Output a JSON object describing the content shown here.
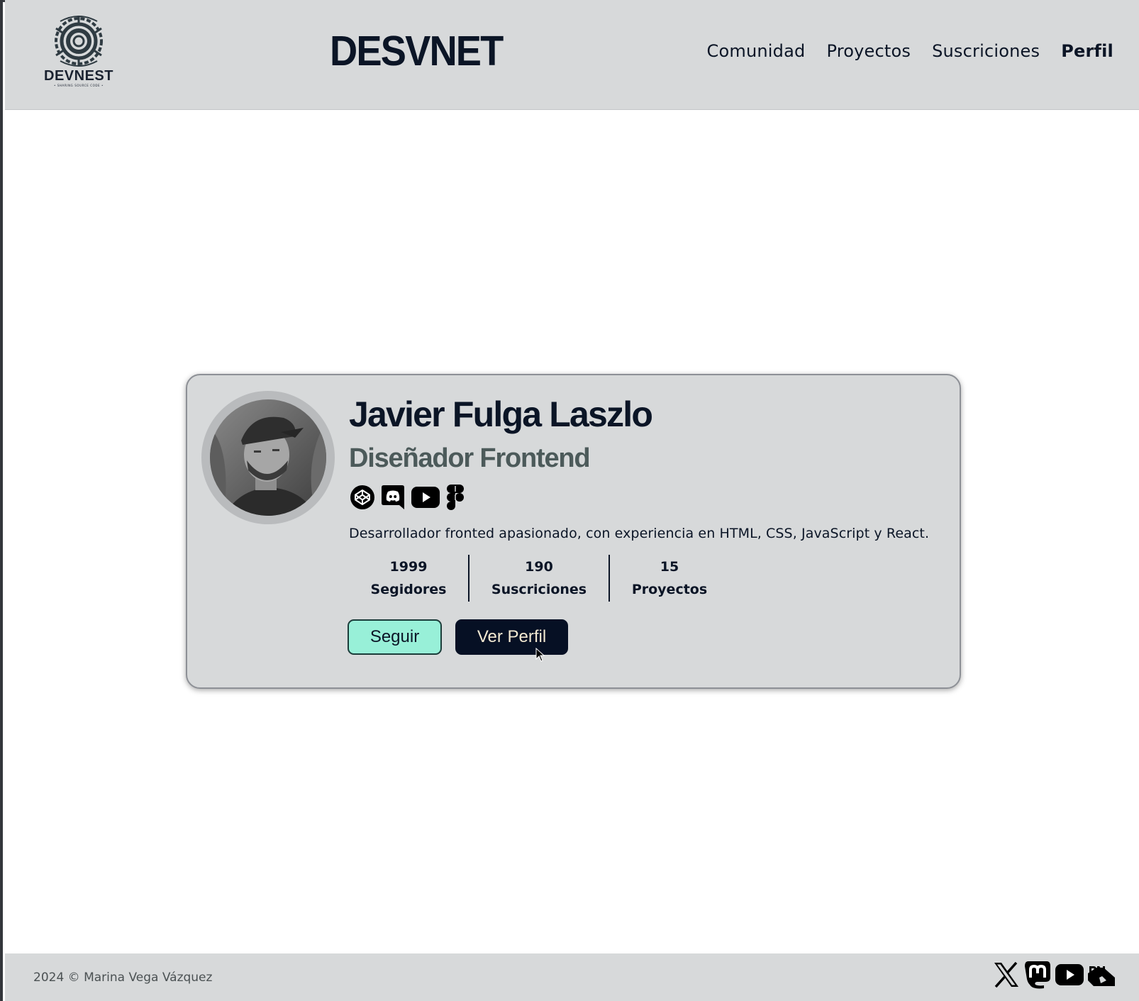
{
  "header": {
    "logo_text": "DEVNEST",
    "logo_tagline": "• SHARING SOURCE CODE •",
    "site_title": "DESVNET",
    "nav": [
      {
        "label": "Comunidad"
      },
      {
        "label": "Proyectos"
      },
      {
        "label": "Suscriciones"
      },
      {
        "label": "Perfil",
        "active": true
      }
    ]
  },
  "profile": {
    "name": "Javier Fulga Laszlo",
    "role": "Diseñador Frontend",
    "socials": [
      "codepen-icon",
      "discord-icon",
      "youtube-icon",
      "figma-icon"
    ],
    "bio": "Desarrollador fronted apasionado, con experiencia en HTML, CSS, JavaScript y React.",
    "stats": [
      {
        "value": "1999",
        "label": "Segidores"
      },
      {
        "value": "190",
        "label": "Suscriciones"
      },
      {
        "value": "15",
        "label": "Proyectos"
      }
    ],
    "follow_button": "Seguir",
    "view_profile_button": "Ver Perfil"
  },
  "footer": {
    "copyright": "2024 © Marina Vega Vázquez",
    "icons": [
      "x-icon",
      "mastodon-icon",
      "youtube-icon",
      "dev-icon"
    ]
  },
  "colors": {
    "header_bg": "#d7d9da",
    "primary": "#0b1526",
    "role_text": "#4c5a5a",
    "follow_bg": "#98f0d8",
    "profile_btn_bg": "#061024",
    "profile_btn_text": "#f3e9d2"
  }
}
